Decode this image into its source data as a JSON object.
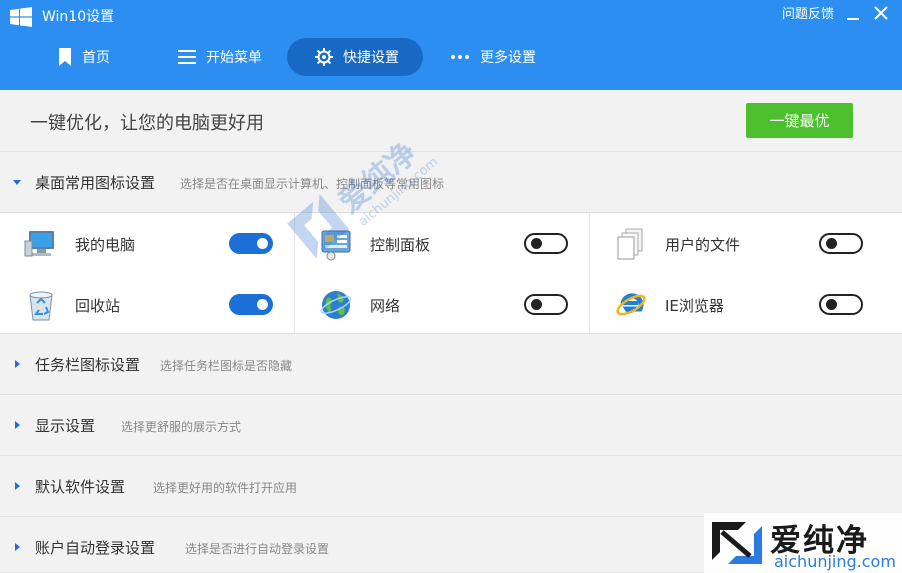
{
  "window": {
    "title": "Win10设置",
    "feedback": "问题反馈"
  },
  "nav": [
    {
      "label": "首页",
      "icon": "bookmark-icon"
    },
    {
      "label": "开始菜单",
      "icon": "menu-icon"
    },
    {
      "label": "快捷设置",
      "icon": "gear-icon",
      "active": true
    },
    {
      "label": "更多设置",
      "icon": "dots-icon"
    }
  ],
  "banner": {
    "text": "一键优化，让您的电脑更好用",
    "button": "一键最优"
  },
  "sections": [
    {
      "title": "桌面常用图标设置",
      "desc": "选择是否在桌面显示计算机、控制面板等常用图标",
      "expanded": true
    },
    {
      "title": "任务栏图标设置",
      "desc": "选择任务栏图标是否隐藏"
    },
    {
      "title": "显示设置",
      "desc": "选择更舒服的展示方式"
    },
    {
      "title": "默认软件设置",
      "desc": "选择更好用的软件打开应用"
    },
    {
      "title": "账户自动登录设置",
      "desc": "选择是否进行自动登录设置"
    }
  ],
  "desktop_icons": [
    {
      "label": "我的电脑",
      "icon": "computer-icon",
      "on": true
    },
    {
      "label": "控制面板",
      "icon": "control-panel-icon",
      "on": false
    },
    {
      "label": "用户的文件",
      "icon": "user-files-icon",
      "on": false
    },
    {
      "label": "回收站",
      "icon": "recycle-bin-icon",
      "on": true
    },
    {
      "label": "网络",
      "icon": "network-globe-icon",
      "on": false
    },
    {
      "label": "IE浏览器",
      "icon": "ie-browser-icon",
      "on": false
    }
  ],
  "watermark": {
    "name": "爱纯净",
    "domain": "aichunjing.com"
  },
  "colors": {
    "header": "#2b8ef0",
    "nav_active": "#1869c4",
    "button": "#4cbf2e",
    "toggle_on": "#1c6fd6"
  }
}
